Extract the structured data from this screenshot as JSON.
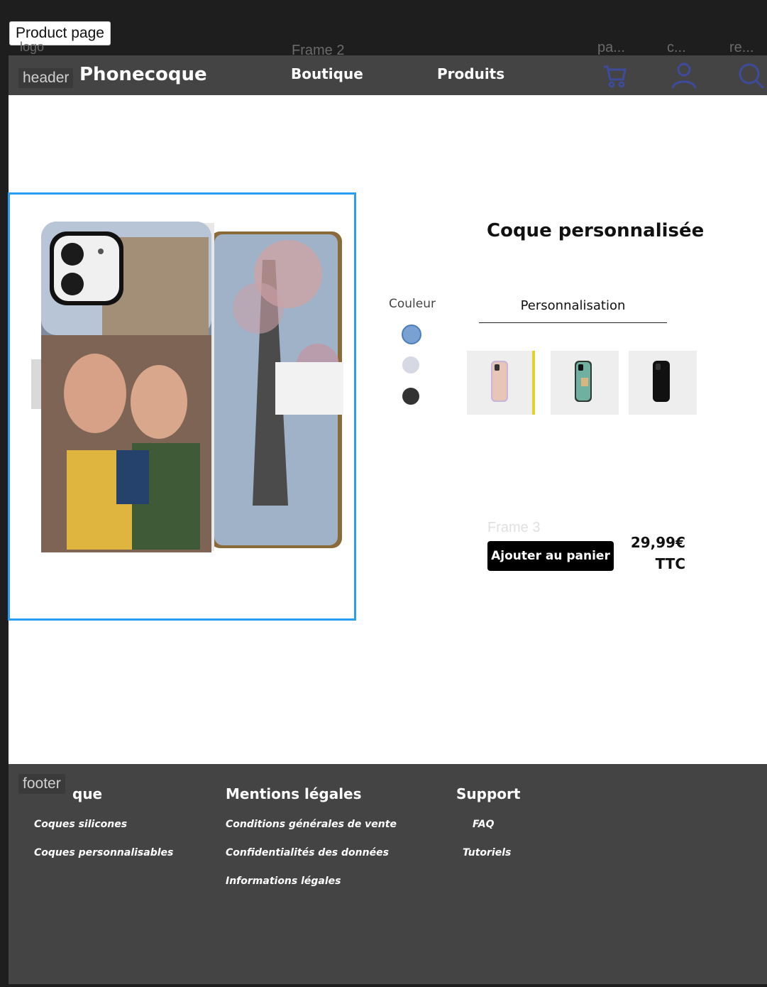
{
  "frame_labels": {
    "page": "Product page",
    "frame2": "Frame 2",
    "logo": "logo",
    "header_chip": "header",
    "footer_chip": "footer",
    "frame3": "Frame 3",
    "icon_labels": [
      "pa...",
      "c...",
      "re..."
    ]
  },
  "header": {
    "brand": "Phonecoque",
    "nav": [
      "Boutique",
      "Produits"
    ]
  },
  "product": {
    "title": "Coque personnalisée",
    "color_label": "Couleur",
    "tab_label": "Personnalisation",
    "add_to_cart": "Ajouter au panier",
    "price": "29,99€",
    "tax": "TTC",
    "swatches": [
      "#7aa1d2",
      "#d6d9e3",
      "#333333"
    ],
    "thumbs": [
      "pastel-case",
      "map-case",
      "black-case"
    ]
  },
  "footer": {
    "columns": [
      {
        "title": "que",
        "links": [
          "Coques silicones",
          "Coques personnalisables"
        ]
      },
      {
        "title": "Mentions légales",
        "links": [
          "Conditions générales de vente",
          "Confidentialités des données",
          "Informations légales"
        ]
      },
      {
        "title": "Support",
        "links": [
          "FAQ",
          "Tutoriels"
        ]
      }
    ]
  }
}
